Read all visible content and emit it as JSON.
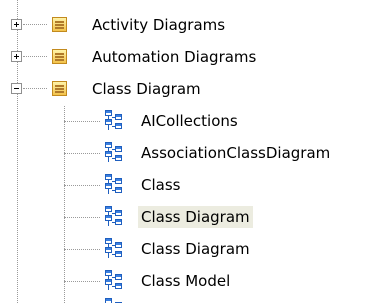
{
  "tree": {
    "items": [
      {
        "label": "Activity Diagrams",
        "type": "package",
        "expander": "collapsed",
        "icon": "package-icon"
      },
      {
        "label": "Automation Diagrams",
        "type": "package",
        "expander": "collapsed",
        "icon": "package-icon"
      },
      {
        "label": "Class Diagram",
        "type": "package",
        "expander": "expanded",
        "icon": "package-icon"
      },
      {
        "label": "AICollections",
        "type": "diagram",
        "icon": "class-diagram-icon"
      },
      {
        "label": "AssociationClassDiagram",
        "type": "diagram",
        "icon": "class-diagram-icon"
      },
      {
        "label": "Class",
        "type": "diagram",
        "icon": "class-diagram-icon"
      },
      {
        "label": "Class Diagram",
        "type": "diagram",
        "icon": "class-diagram-icon",
        "selected": true
      },
      {
        "label": "Class Diagram",
        "type": "diagram",
        "icon": "class-diagram-icon"
      },
      {
        "label": "Class Model",
        "type": "diagram",
        "icon": "class-diagram-icon"
      }
    ]
  },
  "colors": {
    "selection": "#ecece0",
    "connector": "#9a9a9a",
    "package_fill": "#f3c24a",
    "diagram_icon": "#1f5fbf"
  }
}
